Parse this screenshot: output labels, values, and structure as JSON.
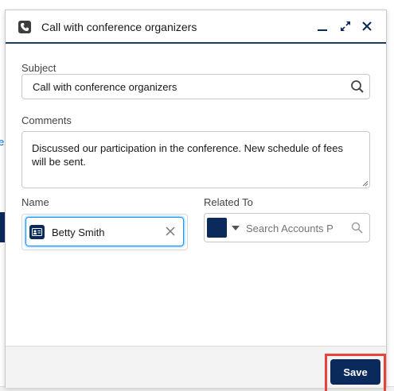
{
  "background": {
    "edge_letter": "e"
  },
  "panel": {
    "title": "Call with conference organizers",
    "header_icon": "call-log-icon",
    "controls": {
      "minimize": "minimize-icon",
      "expand": "expand-icon",
      "close": "close-icon"
    }
  },
  "form": {
    "subject": {
      "label": "Subject",
      "value": "Call with conference organizers",
      "icon": "search-icon"
    },
    "comments": {
      "label": "Comments",
      "value": "Discussed our participation in the conference.  New schedule of fees will be sent."
    },
    "name": {
      "label": "Name",
      "value": "Betty Smith",
      "icon": "contact-card-icon"
    },
    "related_to": {
      "label": "Related To",
      "placeholder": "Search Accounts P",
      "icon": "search-icon"
    }
  },
  "footer": {
    "save_label": "Save"
  },
  "colors": {
    "brand_navy": "#0b2a5c",
    "focus_blue": "#1b96ff",
    "highlight_red": "#e8433a"
  }
}
